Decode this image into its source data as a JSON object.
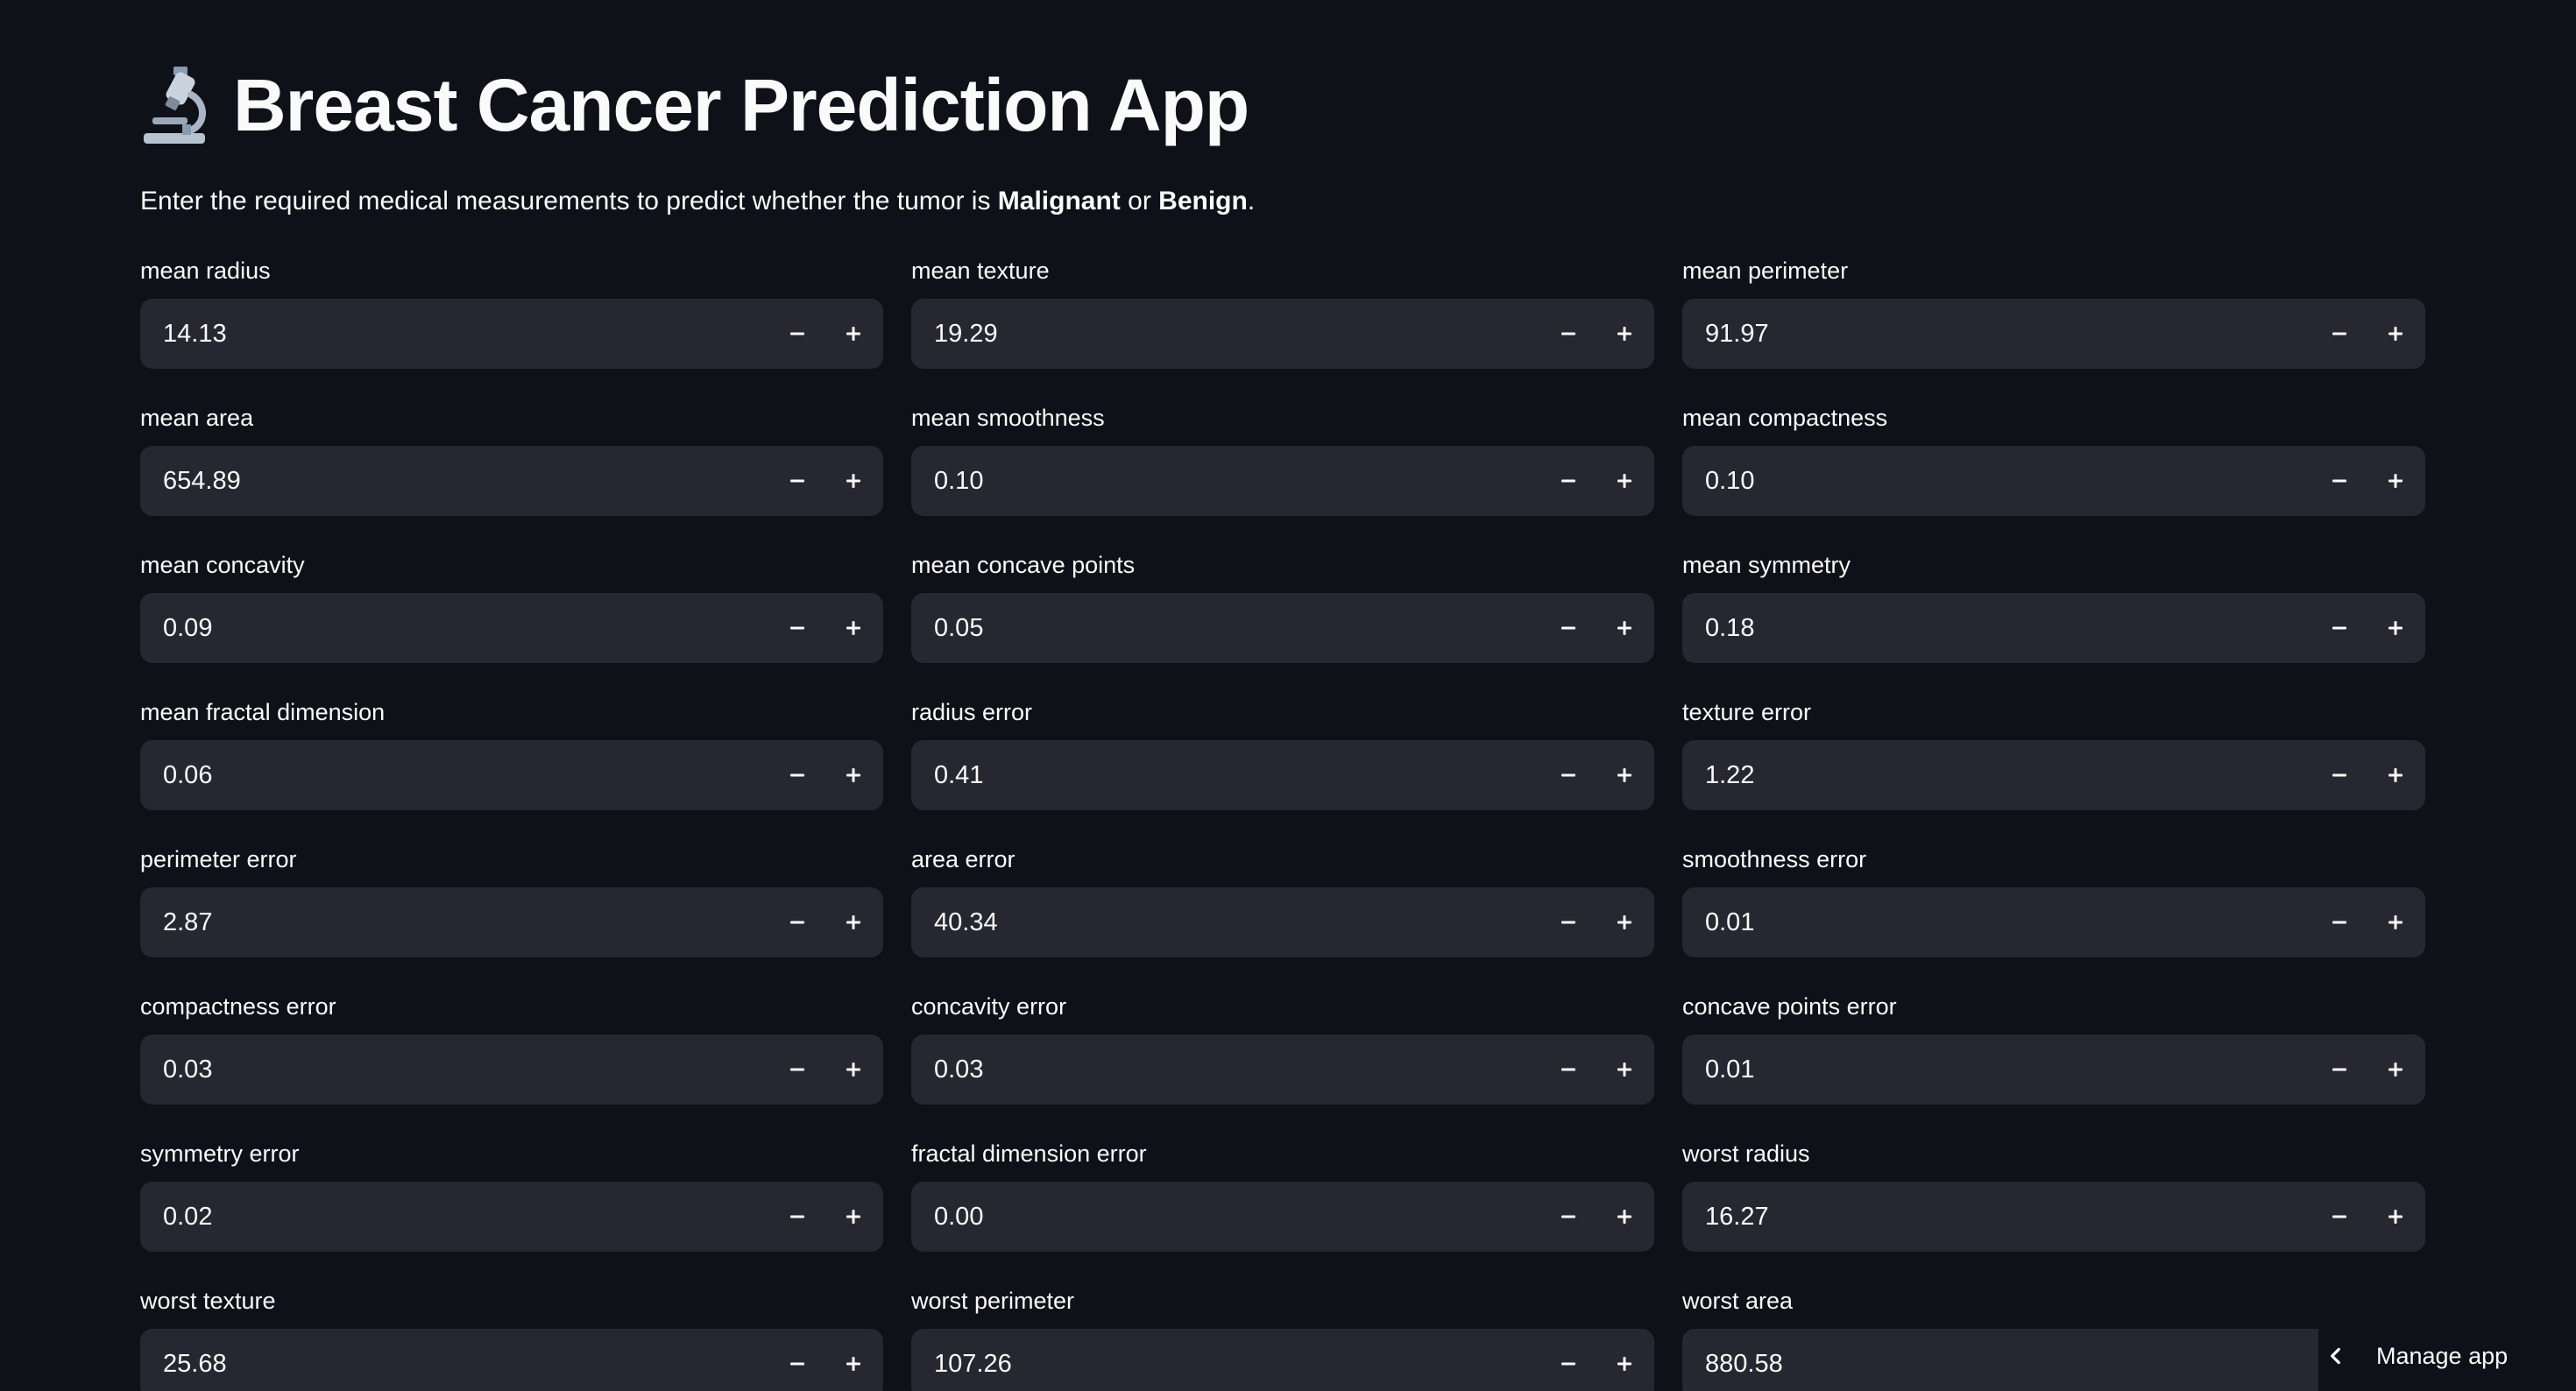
{
  "header": {
    "title": "Breast Cancer Prediction App",
    "icon": "microscope-icon"
  },
  "subtitle": {
    "prefix": "Enter the required medical measurements to predict whether the tumor is ",
    "malignant": "Malignant",
    "or": " or ",
    "benign": "Benign",
    "suffix": "."
  },
  "fields": [
    {
      "label": "mean radius",
      "value": "14.13"
    },
    {
      "label": "mean texture",
      "value": "19.29"
    },
    {
      "label": "mean perimeter",
      "value": "91.97"
    },
    {
      "label": "mean area",
      "value": "654.89"
    },
    {
      "label": "mean smoothness",
      "value": "0.10"
    },
    {
      "label": "mean compactness",
      "value": "0.10"
    },
    {
      "label": "mean concavity",
      "value": "0.09"
    },
    {
      "label": "mean concave points",
      "value": "0.05"
    },
    {
      "label": "mean symmetry",
      "value": "0.18"
    },
    {
      "label": "mean fractal dimension",
      "value": "0.06"
    },
    {
      "label": "radius error",
      "value": "0.41"
    },
    {
      "label": "texture error",
      "value": "1.22"
    },
    {
      "label": "perimeter error",
      "value": "2.87"
    },
    {
      "label": "area error",
      "value": "40.34"
    },
    {
      "label": "smoothness error",
      "value": "0.01"
    },
    {
      "label": "compactness error",
      "value": "0.03"
    },
    {
      "label": "concavity error",
      "value": "0.03"
    },
    {
      "label": "concave points error",
      "value": "0.01"
    },
    {
      "label": "symmetry error",
      "value": "0.02"
    },
    {
      "label": "fractal dimension error",
      "value": "0.00"
    },
    {
      "label": "worst radius",
      "value": "16.27"
    },
    {
      "label": "worst texture",
      "value": "25.68"
    },
    {
      "label": "worst perimeter",
      "value": "107.26"
    },
    {
      "label": "worst area",
      "value": "880.58"
    }
  ],
  "manage_app": {
    "label": "Manage app"
  },
  "colors": {
    "background": "#0e1117",
    "input_background": "#262730",
    "text": "#fafafa"
  }
}
